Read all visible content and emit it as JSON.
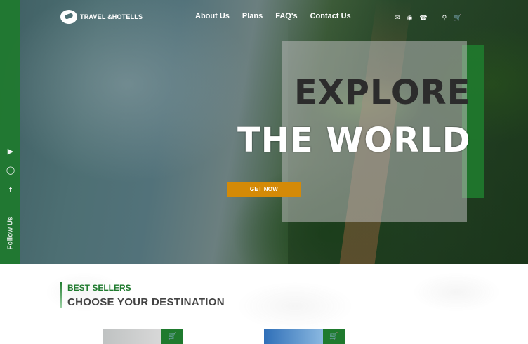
{
  "brand": {
    "name": "TRAVEL &HOTELLS"
  },
  "nav": [
    {
      "label": "About Us"
    },
    {
      "label": "Plans"
    },
    {
      "label": "FAQ's"
    },
    {
      "label": "Contact Us"
    }
  ],
  "tools": {
    "email_icon": "envelope-icon",
    "location_icon": "map-pin-icon",
    "phone_icon": "phone-icon",
    "search_icon": "search-icon",
    "cart_icon": "cart-icon"
  },
  "social": {
    "label": "Follow Us",
    "items": [
      {
        "icon": "youtube-icon"
      },
      {
        "icon": "instagram-icon"
      },
      {
        "icon": "facebook-icon"
      }
    ]
  },
  "hero": {
    "line1": "EXPLORE",
    "line2": "THE WORLD",
    "cta": "GET NOW"
  },
  "section": {
    "kicker": "BEST SELLERS",
    "title": "CHOOSE YOUR DESTINATION"
  },
  "colors": {
    "brand_green": "#1f7a2e",
    "cta_orange": "#d48a07"
  }
}
